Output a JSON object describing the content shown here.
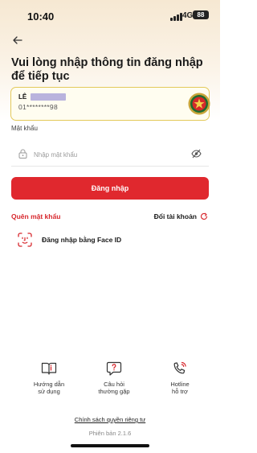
{
  "status_bar": {
    "time": "10:40",
    "network": "4G",
    "battery": "88"
  },
  "header": {
    "back_icon": "arrow-left-icon",
    "title": "Vui lòng nhập thông tin đăng nhập để tiếp tục"
  },
  "account": {
    "name": "LÊ",
    "id_masked": "01********98",
    "logo_icon": "army-emblem-icon"
  },
  "password": {
    "label": "Mật khẩu",
    "placeholder": "Nhập mật khẩu",
    "value": "",
    "lock_icon": "lock-icon",
    "toggle_icon": "eye-icon"
  },
  "login_button": {
    "label": "Đăng nhập",
    "color": "#e0282e"
  },
  "links": {
    "forgot_password": "Quên mật khẩu",
    "switch_account": "Đổi tài khoản",
    "switch_icon": "refresh-icon"
  },
  "face_id": {
    "label": "Đăng nhập bằng Face ID",
    "icon": "face-id-icon"
  },
  "shortcuts": [
    {
      "icon": "book-icon",
      "line1": "Hướng dẫn",
      "line2": "sử dụng"
    },
    {
      "icon": "question-chat-icon",
      "line1": "Câu hỏi",
      "line2": "thường gặp"
    },
    {
      "icon": "phone-ring-icon",
      "line1": "Hotline",
      "line2": "hỗ trợ"
    }
  ],
  "footer": {
    "privacy": "Chính sách quyền riêng tư",
    "version": "Phiên bản 2.1.6"
  },
  "colors": {
    "accent": "#e0282e",
    "card_border": "#e3c95a",
    "header_bg": "#f6e8d2"
  }
}
